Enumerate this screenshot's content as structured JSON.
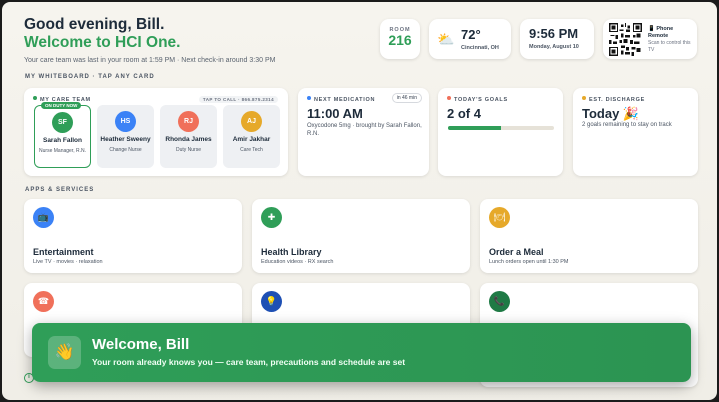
{
  "header": {
    "greeting": "Good evening, Bill.",
    "welcome": "Welcome to HCI One.",
    "subtitle": "Your care team was last in your room at 1:59 PM · Next check-in around 3:30 PM"
  },
  "status": {
    "room_label": "ROOM",
    "room_number": "216",
    "weather_icon": "partly-cloudy-icon",
    "temperature": "72°",
    "city": "Cincinnati, OH",
    "time": "9:56 PM",
    "date": "Monday, August 10",
    "remote_title": "📱 Phone Remote",
    "remote_sub": "Scan to control this TV"
  },
  "whiteboard": {
    "section_label": "MY WHITEBOARD · TAP ANY CARD",
    "care_team": {
      "label": "MY CARE TEAM",
      "tap_to_call": "TAP TO CALL · 866.875.2314",
      "on_duty": "ON DUTY NOW",
      "members": [
        {
          "initials": "SF",
          "name": "Sarah Fallon",
          "role": "Nurse Manager, R.N.",
          "color": "#2f9e58"
        },
        {
          "initials": "HS",
          "name": "Heather Sweeny",
          "role": "Change Nurse",
          "color": "#3b82f6"
        },
        {
          "initials": "RJ",
          "name": "Rhonda James",
          "role": "Duty Nurse",
          "color": "#f0705a"
        },
        {
          "initials": "AJ",
          "name": "Amir Jakhar",
          "role": "Care Tech",
          "color": "#e6a92a"
        }
      ]
    },
    "medication": {
      "label": "NEXT MEDICATION",
      "badge": "in 46 min",
      "time": "11:00 AM",
      "detail": "Oxycodone 5mg · brought by Sarah Fallon, R.N."
    },
    "goals": {
      "label": "TODAY'S GOALS",
      "value": "2 of 4",
      "progress": 0.5
    },
    "discharge": {
      "label": "EST. DISCHARGE",
      "value": "Today 🎉",
      "detail": "2 goals remaining to stay on track"
    }
  },
  "apps": {
    "section_label": "APPS & SERVICES",
    "items": [
      {
        "icon": "tv-icon",
        "glyph": "📺",
        "color": "#3b82f6",
        "name": "Entertainment",
        "desc": "Live TV · movies · relaxation"
      },
      {
        "icon": "plus-icon",
        "glyph": "✚",
        "color": "#2f9e58",
        "name": "Health Library",
        "desc": "Education videos · RX search"
      },
      {
        "icon": "meal-icon",
        "glyph": "🍽",
        "color": "#e6a92a",
        "name": "Order a Meal",
        "desc": "Lunch orders open until 1:30 PM"
      },
      {
        "icon": "concierge-icon",
        "glyph": "☎",
        "color": "#f0705a",
        "name": "",
        "desc": ""
      },
      {
        "icon": "lightbulb-icon",
        "glyph": "💡",
        "color": "#1e50b4",
        "name": "",
        "desc": ""
      },
      {
        "icon": "phone-icon",
        "glyph": "📞",
        "color": "#1f7a45",
        "name": "",
        "desc": ""
      }
    ]
  },
  "toast": {
    "icon": "wave-icon",
    "glyph": "👋",
    "title": "Welcome, Bill",
    "message": "Your room already knows you — care team, precautions and schedule are set"
  },
  "colors": {
    "accent": "#2f9e58",
    "navy": "#1d2b3a"
  }
}
